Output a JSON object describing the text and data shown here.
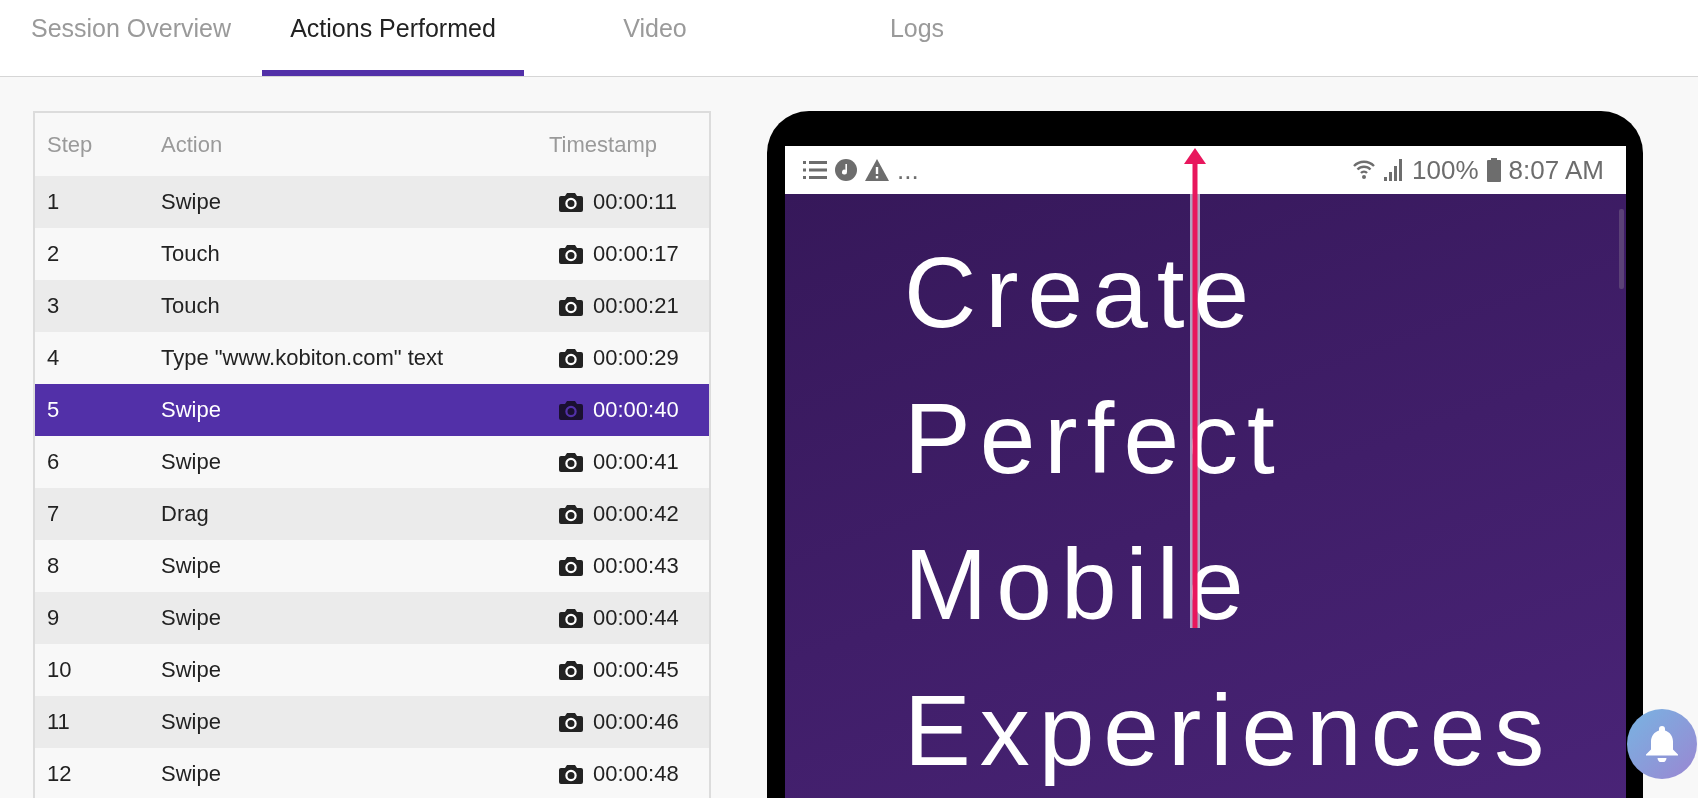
{
  "tabs": [
    {
      "label": "Session Overview",
      "selected": false
    },
    {
      "label": "Actions Performed",
      "selected": true
    },
    {
      "label": "Video",
      "selected": false
    },
    {
      "label": "Logs",
      "selected": false
    }
  ],
  "actions_table": {
    "columns": [
      "Step",
      "Action",
      "Timestamp"
    ],
    "rows": [
      {
        "step": "1",
        "action": "Swipe",
        "timestamp": "00:00:11",
        "selected": false
      },
      {
        "step": "2",
        "action": "Touch",
        "timestamp": "00:00:17",
        "selected": false
      },
      {
        "step": "3",
        "action": "Touch",
        "timestamp": "00:00:21",
        "selected": false
      },
      {
        "step": "4",
        "action": "Type \"www.kobiton.com\" text",
        "timestamp": "00:00:29",
        "selected": false
      },
      {
        "step": "5",
        "action": "Swipe",
        "timestamp": "00:00:40",
        "selected": true
      },
      {
        "step": "6",
        "action": "Swipe",
        "timestamp": "00:00:41",
        "selected": false
      },
      {
        "step": "7",
        "action": "Drag",
        "timestamp": "00:00:42",
        "selected": false
      },
      {
        "step": "8",
        "action": "Swipe",
        "timestamp": "00:00:43",
        "selected": false
      },
      {
        "step": "9",
        "action": "Swipe",
        "timestamp": "00:00:44",
        "selected": false
      },
      {
        "step": "10",
        "action": "Swipe",
        "timestamp": "00:00:45",
        "selected": false
      },
      {
        "step": "11",
        "action": "Swipe",
        "timestamp": "00:00:46",
        "selected": false
      },
      {
        "step": "12",
        "action": "Swipe",
        "timestamp": "00:00:48",
        "selected": false
      }
    ]
  },
  "device": {
    "status_bar": {
      "overflow": "...",
      "battery": "100%",
      "time": "8:07 AM"
    },
    "screen_text": [
      "Create",
      "Perfect",
      "Mobile",
      "Experiences"
    ]
  }
}
